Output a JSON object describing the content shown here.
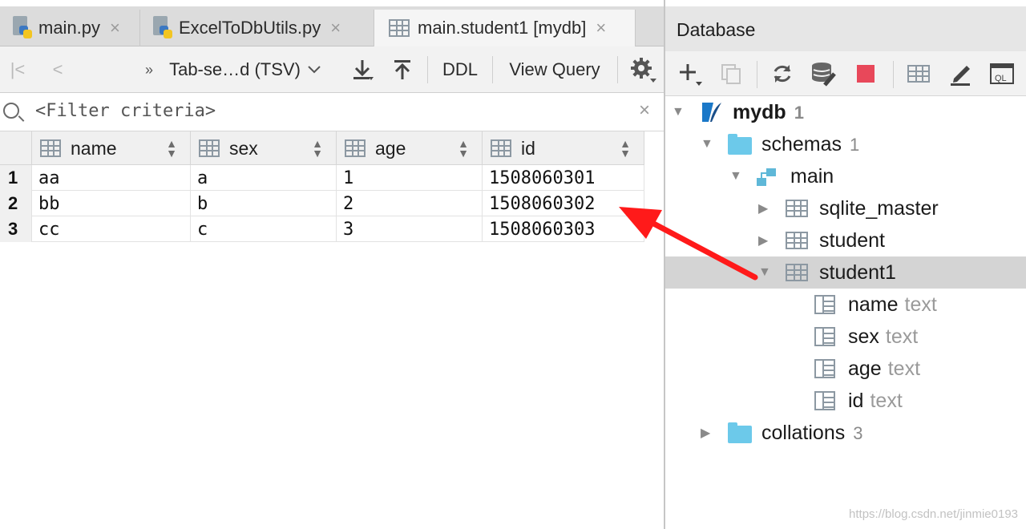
{
  "tabs": [
    {
      "label": "main.py",
      "close": "×"
    },
    {
      "label": "ExcelToDbUtils.py",
      "close": "×"
    },
    {
      "label": "main.student1 [mydb]",
      "close": "×"
    }
  ],
  "toolbar": {
    "first": "|<",
    "prev": "<",
    "more": "»",
    "format_label": "Tab-se…d (TSV)",
    "ddl_label": "DDL",
    "view_query_label": "View Query"
  },
  "filter": {
    "placeholder": "<Filter criteria>"
  },
  "table": {
    "columns": [
      "name",
      "sex",
      "age",
      "id"
    ],
    "rows": [
      {
        "num": "1",
        "cells": [
          "aa",
          "a",
          "1",
          "1508060301"
        ]
      },
      {
        "num": "2",
        "cells": [
          "bb",
          "b",
          "2",
          "1508060302"
        ]
      },
      {
        "num": "3",
        "cells": [
          "cc",
          "c",
          "3",
          "1508060303"
        ]
      }
    ]
  },
  "database": {
    "title": "Database",
    "root": {
      "label": "mydb",
      "count": "1"
    },
    "schemas": {
      "label": "schemas",
      "count": "1"
    },
    "main": {
      "label": "main"
    },
    "tables": [
      {
        "label": "sqlite_master"
      },
      {
        "label": "student"
      },
      {
        "label": "student1"
      }
    ],
    "columns": [
      {
        "label": "name",
        "type": "text"
      },
      {
        "label": "sex",
        "type": "text"
      },
      {
        "label": "age",
        "type": "text"
      },
      {
        "label": "id",
        "type": "text"
      }
    ],
    "collations": {
      "label": "collations",
      "count": "3"
    }
  },
  "watermark": "https://blog.csdn.net/jinmie0193",
  "colors": {
    "arrow": "#ff1a1a",
    "folder": "#6cc9ea",
    "stop": "#e8485a",
    "selection": "#d4d4d4"
  }
}
